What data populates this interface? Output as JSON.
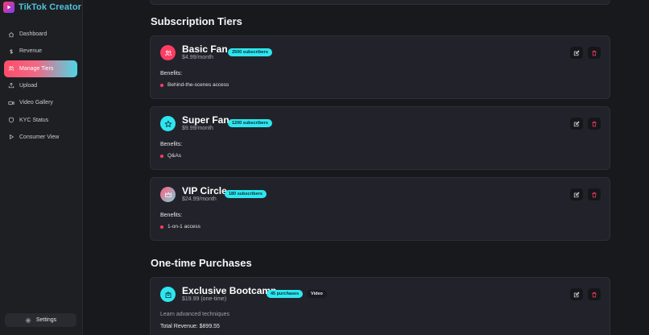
{
  "app": {
    "brand": "TikTok Creator"
  },
  "sidebar": {
    "items": [
      {
        "label": "Dashboard",
        "icon": "home-icon"
      },
      {
        "label": "Revenue",
        "icon": "dollar-icon"
      },
      {
        "label": "Manage Tiers",
        "icon": "users-icon",
        "active": true
      },
      {
        "label": "Upload",
        "icon": "upload-icon"
      },
      {
        "label": "Video Gallery",
        "icon": "video-icon"
      },
      {
        "label": "KYC Status",
        "icon": "shield-icon"
      },
      {
        "label": "Consumer View",
        "icon": "play-icon"
      }
    ],
    "settings_label": "Settings"
  },
  "sections": {
    "tiers_title": "Subscription Tiers",
    "purchases_title": "One-time Purchases"
  },
  "tiers": [
    {
      "name": "Basic Fan",
      "price": "$4.99/month",
      "subscribers": "2500 subscribers",
      "benefits_label": "Benefits:",
      "benefits": [
        "Behind-the-scenes access"
      ],
      "icon": "users-icon",
      "color": "#ff3d64"
    },
    {
      "name": "Super Fan",
      "price": "$9.99/month",
      "subscribers": "1200 subscribers",
      "benefits_label": "Benefits:",
      "benefits": [
        "Q&As"
      ],
      "icon": "star-icon",
      "color": "#2ee6f0"
    },
    {
      "name": "VIP Circle",
      "price": "$24.99/month",
      "subscribers": "180 subscribers",
      "benefits_label": "Benefits:",
      "benefits": [
        "1-on-1 access"
      ],
      "icon": "crown-icon",
      "color": "#c77a9a"
    }
  ],
  "purchases": [
    {
      "name": "Exclusive Bootcamp",
      "price": "$19.99 (one-time)",
      "count": "45 purchases",
      "type": "Video",
      "description": "Learn advanced techniques",
      "revenue": "Total Revenue: $899.55",
      "icon": "bag-icon",
      "color": "#2ee6f0"
    }
  ],
  "colors": {
    "accent_pink": "#ff3d64",
    "accent_cyan": "#2ee6f0",
    "bg": "#18191d"
  }
}
